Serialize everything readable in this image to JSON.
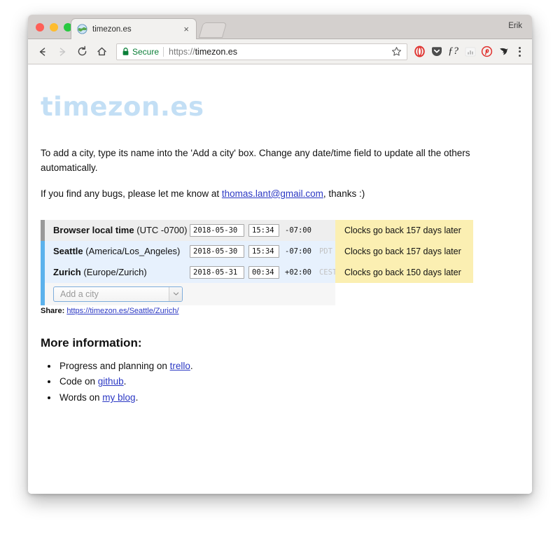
{
  "browser": {
    "profile_name": "Erik",
    "tab": {
      "title": "timezon.es",
      "favicon": "globe-icon",
      "close_label": "×"
    },
    "toolbar": {
      "back": "back-arrow-icon",
      "forward": "forward-arrow-icon",
      "reload": "reload-icon",
      "home": "home-icon",
      "security_label": "Secure",
      "url_scheme": "https://",
      "url_host": "timezon.es",
      "bookmark": "star-icon",
      "menu": "three-dot-menu-icon",
      "extensions": [
        {
          "name": "opera-icon",
          "glyph": "O",
          "color": "#e0322f"
        },
        {
          "name": "pocket-shield-icon",
          "glyph": "▼",
          "color": "#4d4d4d"
        },
        {
          "name": "function-question-icon",
          "glyph": "ƒ?",
          "color": "#2b2b2b"
        },
        {
          "name": "chart-icon",
          "glyph": "▃▅",
          "color": "#c9c9c9"
        },
        {
          "name": "pinterest-icon",
          "glyph": "Ⓟ",
          "color": "#e0322f"
        },
        {
          "name": "bird-cursor-icon",
          "glyph": "➤",
          "color": "#2b2b2b"
        }
      ]
    }
  },
  "page": {
    "title": "timezon.es",
    "intro_paragraph": "To add a city, type its name into the 'Add a city' box. Change any date/time field to update all the others automatically.",
    "bugs_prefix": "If you find any bugs, please let me know at ",
    "bugs_email": "thomas.lant@gmail.com",
    "bugs_suffix": ", thanks :)",
    "rows": [
      {
        "name": "Browser local time",
        "zone": "(UTC -0700)",
        "date": "2018-05-30",
        "time": "15:34",
        "offset": "-07:00",
        "abbr": "",
        "dst": "Clocks go back 157 days later",
        "kind": "local"
      },
      {
        "name": "Seattle",
        "zone": "(America/Los_Angeles)",
        "date": "2018-05-30",
        "time": "15:34",
        "offset": "-07:00",
        "abbr": "PDT",
        "dst": "Clocks go back 157 days later",
        "kind": "city"
      },
      {
        "name": "Zurich",
        "zone": "(Europe/Zurich)",
        "date": "2018-05-31",
        "time": "00:34",
        "offset": "+02:00",
        "abbr": "CEST",
        "dst": "Clocks go back 150 days later",
        "kind": "city"
      }
    ],
    "add_city_placeholder": "Add a city",
    "share_label": "Share:",
    "share_url": "https://timezon.es/Seattle/Zurich/",
    "more_info_heading": "More information:",
    "info_items": [
      {
        "prefix": "Progress and planning on ",
        "link": "trello",
        "suffix": "."
      },
      {
        "prefix": "Code on ",
        "link": "github",
        "suffix": "."
      },
      {
        "prefix": "Words on ",
        "link": "my blog",
        "suffix": "."
      }
    ]
  },
  "colors": {
    "title": "#c3dff5",
    "local_bar": "#999999",
    "city_bar": "#5cb2ec",
    "dst_panel": "#fbefb2",
    "link": "#2b38c4",
    "secure": "#0b7f38"
  }
}
